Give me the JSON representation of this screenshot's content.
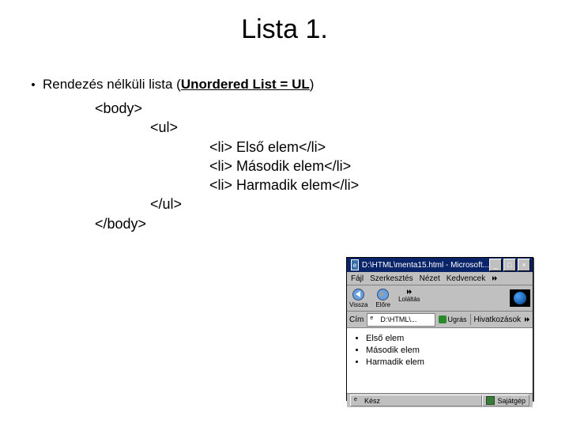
{
  "title": "Lista 1.",
  "bullet": {
    "lead": "Rendezés nélküli lista (",
    "bold": "Unordered List = UL",
    "tail": ")"
  },
  "code": {
    "body_open": "<body>",
    "ul_open": "<ul>",
    "li1": "<li> Első elem</li>",
    "li2": "<li> Második elem</li>",
    "li3": "<li> Harmadik elem</li>",
    "ul_close": "</ul>",
    "body_close": "</body>"
  },
  "browser": {
    "title": "D:\\HTML\\menta15.html - Microsoft...",
    "btn_min": "_",
    "btn_max": "□",
    "btn_close": "×",
    "menu": {
      "file": "Fájl",
      "edit": "Szerkesztés",
      "view": "Nézet",
      "fav": "Kedvencek"
    },
    "tool": {
      "back": "Vissza",
      "fwd": "Előre",
      "more": "Loláltás"
    },
    "addr": {
      "label": "Cím",
      "value": "D:\\HTML\\...",
      "go": "Ugrás",
      "links": "Hivatkozások"
    },
    "list": {
      "i1": "Első elem",
      "i2": "Második elem",
      "i3": "Harmadik elem"
    },
    "status": {
      "done": "Kész",
      "zone": "Sajátgép"
    }
  }
}
